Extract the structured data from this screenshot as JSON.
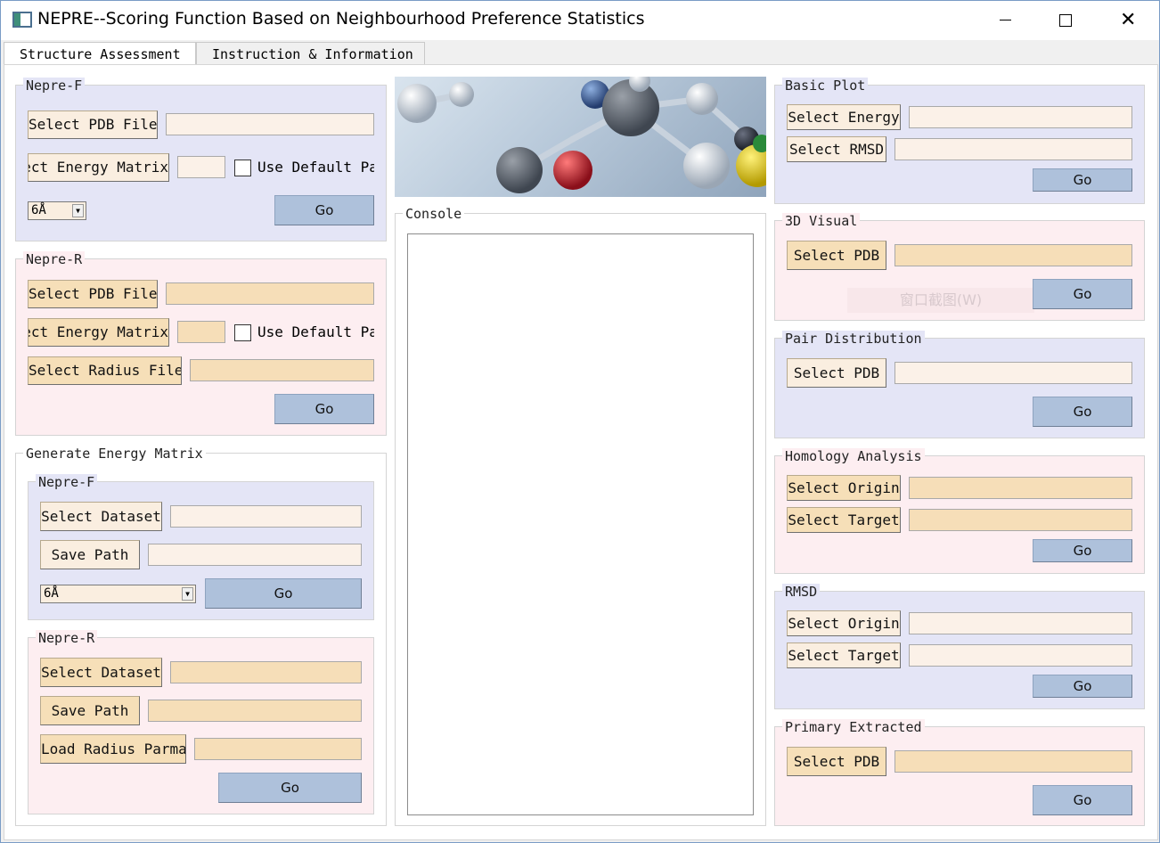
{
  "window": {
    "title": "NEPRE--Scoring Function Based on Neighbourhood Preference Statistics",
    "minimize_icon": "minimize-icon",
    "maximize_icon": "maximize-icon",
    "close_glyph": "✕"
  },
  "tabs": [
    {
      "label": "Structure Assessment",
      "selected": true
    },
    {
      "label": "Instruction & Information",
      "selected": false
    }
  ],
  "left": {
    "nepre_f": {
      "title": "Nepre-F",
      "select_pdb": "Select PDB File",
      "select_energy": "Select Energy Matrix",
      "use_default": "Use Default Parameters",
      "radius_value": "6Å",
      "go": "Go"
    },
    "nepre_r": {
      "title": "Nepre-R",
      "select_pdb": "Select PDB File",
      "select_energy": "Select Energy Matrix",
      "use_default": "Use Default Parameters",
      "select_radius": "Select Radius File",
      "go": "Go"
    },
    "generate": {
      "title": "Generate Energy Matrix",
      "nepre_f": {
        "title": "Nepre-F",
        "select_dataset": "Select Dataset",
        "save_path": "Save Path",
        "radius_value": "6Å",
        "go": "Go"
      },
      "nepre_r": {
        "title": "Nepre-R",
        "select_dataset": "Select Dataset",
        "save_path": "Save Path",
        "load_radius": "Load Radius Parma",
        "go": "Go"
      }
    }
  },
  "console": {
    "title": "Console"
  },
  "right": {
    "basic_plot": {
      "title": "Basic Plot",
      "select_energy": "Select Energy",
      "select_rmsd": "Select RMSD",
      "go": "Go"
    },
    "visual3d": {
      "title": "3D Visual",
      "select_pdb": "Select PDB",
      "go": "Go",
      "overlay_text": "窗口截图(W)"
    },
    "pair_distribution": {
      "title": "Pair Distribution",
      "select_pdb": "Select PDB",
      "go": "Go"
    },
    "homology": {
      "title": "Homology Analysis",
      "select_origin": "Select Origin",
      "select_target": "Select Target",
      "go": "Go"
    },
    "rmsd": {
      "title": "RMSD",
      "select_origin": "Select Origin",
      "select_target": "Select Target",
      "go": "Go"
    },
    "primary": {
      "title": "Primary Extracted",
      "select_pdb": "Select PDB",
      "go": "Go"
    }
  }
}
